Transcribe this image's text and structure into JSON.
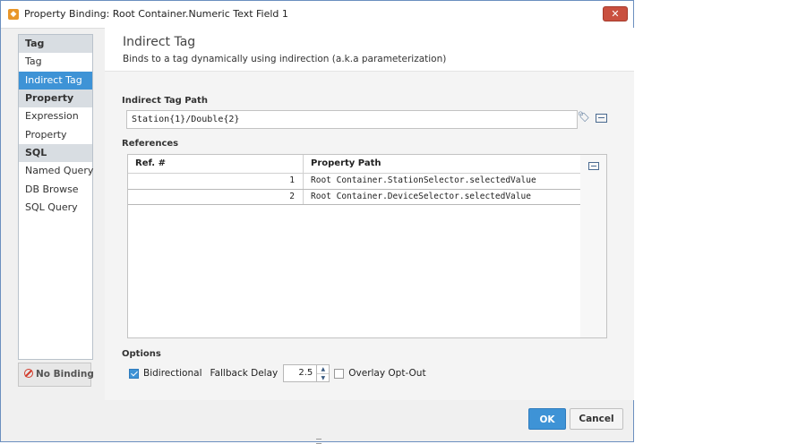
{
  "window": {
    "title": "Property Binding: Root Container.Numeric Text Field 1",
    "close_label": "✕"
  },
  "sidebar": {
    "groups": [
      {
        "header": "Tag",
        "items": [
          "Tag",
          "Indirect Tag"
        ]
      },
      {
        "header": "Property",
        "items": [
          "Expression",
          "Property"
        ]
      },
      {
        "header": "SQL",
        "items": [
          "Named Query",
          "DB Browse",
          "SQL Query"
        ]
      }
    ],
    "selected": "Indirect Tag",
    "no_binding_label": "No Binding"
  },
  "main": {
    "title": "Indirect Tag",
    "subtitle": "Binds to a tag dynamically using indirection (a.k.a parameterization)",
    "indirect_tag_path_label": "Indirect Tag Path",
    "indirect_tag_path_value": "Station{1}/Double{2}",
    "references_label": "References",
    "references_table": {
      "columns": [
        "Ref. #",
        "Property Path"
      ],
      "rows": [
        {
          "ref": "1",
          "path": "Root Container.StationSelector.selectedValue"
        },
        {
          "ref": "2",
          "path": "Root Container.DeviceSelector.selectedValue"
        }
      ]
    },
    "options_label": "Options",
    "options": {
      "bidirectional_label": "Bidirectional",
      "bidirectional_checked": true,
      "fallback_delay_label": "Fallback Delay",
      "fallback_delay_value": "2.5",
      "overlay_opt_out_label": "Overlay Opt-Out",
      "overlay_opt_out_checked": false
    }
  },
  "footer": {
    "ok_label": "OK",
    "cancel_label": "Cancel"
  },
  "colors": {
    "accent": "#3e93d6",
    "close_button": "#c9503f",
    "no_binding_icon": "#d13b2b"
  }
}
